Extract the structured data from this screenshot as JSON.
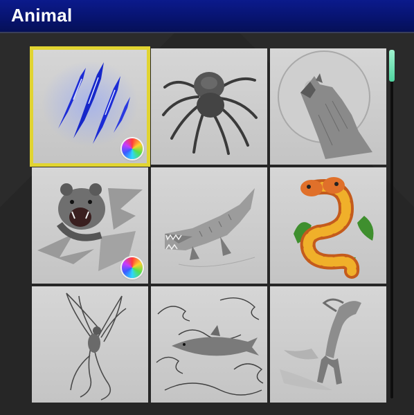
{
  "header": {
    "title": "Animal"
  },
  "colors": {
    "header": "#07136e",
    "selection": "#e1d431",
    "scroll_thumb": "#4fd4a0"
  },
  "tiles": [
    {
      "name": "claw-scratch",
      "icon": "claw-scratch-icon",
      "selected": true,
      "color_badge": true
    },
    {
      "name": "spider",
      "icon": "spider-icon",
      "selected": false,
      "color_badge": false
    },
    {
      "name": "howling-wolf",
      "icon": "wolf-icon",
      "selected": false,
      "color_badge": false
    },
    {
      "name": "bear-tearing",
      "icon": "bear-icon",
      "selected": false,
      "color_badge": true
    },
    {
      "name": "crocodile",
      "icon": "crocodile-icon",
      "selected": false,
      "color_badge": false
    },
    {
      "name": "two-headed-snake",
      "icon": "snake-icon",
      "selected": false,
      "color_badge": false
    },
    {
      "name": "phoenix",
      "icon": "phoenix-icon",
      "selected": false,
      "color_badge": false
    },
    {
      "name": "shark-waves",
      "icon": "shark-icon",
      "selected": false,
      "color_badge": false
    },
    {
      "name": "running-horse",
      "icon": "horse-icon",
      "selected": false,
      "color_badge": false
    }
  ],
  "scroll": {
    "position": 0.0
  }
}
